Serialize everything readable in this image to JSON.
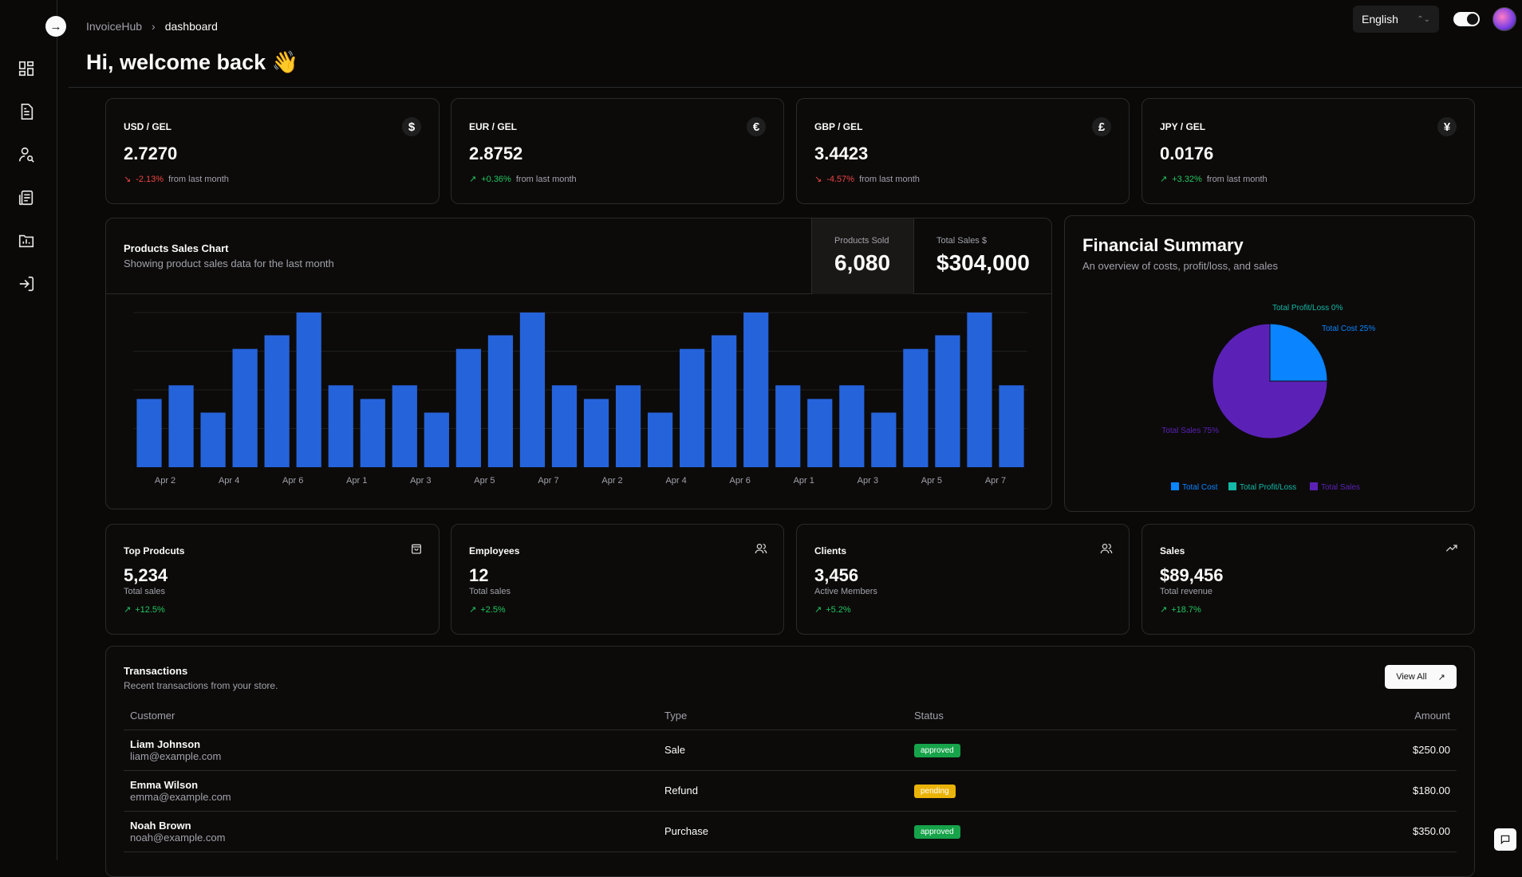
{
  "breadcrumb": {
    "root": "InvoiceHub",
    "current": "dashboard"
  },
  "header": {
    "title": "Hi, welcome back 👋",
    "language": "English"
  },
  "rates": [
    {
      "pair": "USD / GEL",
      "symbol": "$",
      "value": "2.7270",
      "change": "-2.13%",
      "direction": "down",
      "note": "from last month"
    },
    {
      "pair": "EUR / GEL",
      "symbol": "€",
      "value": "2.8752",
      "change": "+0.36%",
      "direction": "up",
      "note": "from last month"
    },
    {
      "pair": "GBP / GEL",
      "symbol": "£",
      "value": "3.4423",
      "change": "-4.57%",
      "direction": "down",
      "note": "from last month"
    },
    {
      "pair": "JPY / GEL",
      "symbol": "¥",
      "value": "0.0176",
      "change": "+3.32%",
      "direction": "up",
      "note": "from last month"
    }
  ],
  "sales_chart": {
    "title": "Products Sales Chart",
    "subtitle": "Showing product sales data for the last month",
    "products_sold_label": "Products Sold",
    "products_sold": "6,080",
    "total_sales_label": "Total Sales $",
    "total_sales": "$304,000"
  },
  "financial_summary": {
    "title": "Financial Summary",
    "subtitle": "An overview of costs, profit/loss, and sales",
    "labels": {
      "profit": "Total Profit/Loss 0%",
      "cost": "Total Cost 25%",
      "sales": "Total Sales 75%"
    },
    "legend": [
      "Total Cost",
      "Total Profit/Loss",
      "Total Sales"
    ]
  },
  "chart_data": [
    {
      "type": "bar",
      "categories": [
        "Apr 1",
        "Apr 2",
        "Apr 3",
        "Apr 4",
        "Apr 5",
        "Apr 6",
        "Apr 7",
        "Apr 1",
        "Apr 2",
        "Apr 3",
        "Apr 4",
        "Apr 5",
        "Apr 6",
        "Apr 7",
        "Apr 1",
        "Apr 2",
        "Apr 3",
        "Apr 4",
        "Apr 5",
        "Apr 6",
        "Apr 7",
        "Apr 1",
        "Apr 2",
        "Apr 3",
        "Apr 4",
        "Apr 5",
        "Apr 6",
        "Apr 7"
      ],
      "tick_labels": [
        "Apr 2",
        "Apr 4",
        "Apr 6",
        "Apr 1",
        "Apr 3",
        "Apr 5",
        "Apr 7",
        "Apr 2",
        "Apr 4",
        "Apr 6",
        "Apr 1",
        "Apr 3",
        "Apr 5",
        "Apr 7"
      ],
      "values": [
        150,
        180,
        120,
        260,
        290,
        340,
        180,
        150,
        180,
        120,
        260,
        290,
        340,
        180,
        150,
        180,
        120,
        260,
        290,
        340,
        180,
        150,
        180,
        120,
        260,
        290,
        340,
        180
      ],
      "ylim": [
        0,
        340
      ],
      "grid": true,
      "color": "#2563db"
    },
    {
      "type": "pie",
      "slices": [
        {
          "name": "Total Cost",
          "value": 25,
          "color": "#0a84ff"
        },
        {
          "name": "Total Profit/Loss",
          "value": 0,
          "color": "#14b8a6"
        },
        {
          "name": "Total Sales",
          "value": 75,
          "color": "#5b21b6"
        }
      ]
    }
  ],
  "kpis": [
    {
      "label": "Top Prodcuts",
      "icon": "bag-icon",
      "value": "5,234",
      "caption": "Total sales",
      "change": "+12.5%"
    },
    {
      "label": "Employees",
      "icon": "users-icon",
      "value": "12",
      "caption": "Total sales",
      "change": "+2.5%"
    },
    {
      "label": "Clients",
      "icon": "users-icon",
      "value": "3,456",
      "caption": "Active Members",
      "change": "+5.2%"
    },
    {
      "label": "Sales",
      "icon": "trending-up-icon",
      "value": "$89,456",
      "caption": "Total revenue",
      "change": "+18.7%"
    }
  ],
  "transactions": {
    "title": "Transactions",
    "subtitle": "Recent transactions from your store.",
    "view_all": "View All",
    "columns": [
      "Customer",
      "Type",
      "Status",
      "Amount"
    ],
    "rows": [
      {
        "name": "Liam Johnson",
        "email": "liam@example.com",
        "type": "Sale",
        "status": "approved",
        "amount": "$250.00"
      },
      {
        "name": "Emma Wilson",
        "email": "emma@example.com",
        "type": "Refund",
        "status": "pending",
        "amount": "$180.00"
      },
      {
        "name": "Noah Brown",
        "email": "noah@example.com",
        "type": "Purchase",
        "status": "approved",
        "amount": "$350.00"
      }
    ]
  }
}
